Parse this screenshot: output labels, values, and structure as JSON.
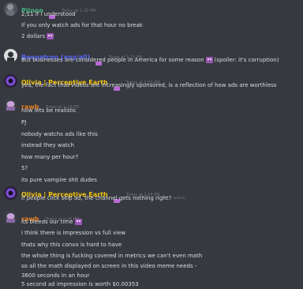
{
  "messages": [
    {
      "author": "Pjinon",
      "author_color": "#43b581",
      "timestamp": "Today at 1:22 PM",
      "lines": [
        "2,11 if i understood",
        "if you only watch ads for that hour no break",
        "2 dollars"
      ]
    },
    {
      "author": "Beepatron (any/all)",
      "author_color": "#5865f2",
      "timestamp": "Today at 1:23 PM",
      "lines": [
        "But businesses are considered people in America for some reason",
        "(spoiler: it's corruption)"
      ]
    },
    {
      "author": "Olivia | Perceptive Earth",
      "author_color": "#f1c40f",
      "timestamp": "Today at 1:23 PM",
      "lines": [
        "yea, the fact that videos are increasingly sponsored, is a reflection of how ads are worthless"
      ]
    },
    {
      "author": "rawb",
      "author_color": "#e67e22",
      "timestamp": "Today at 1:23 PM",
      "lines": [
        "now lets be realistic",
        "PJ",
        "nobody watchs ads like this",
        "instead they watch",
        "how many per hour?",
        "5?",
        "its pure vampire shit dudes"
      ]
    },
    {
      "author": "Olivia | Perceptive Earth",
      "author_color": "#f1c40f",
      "timestamp": "Today at 1:24 PM",
      "lines": [
        "If people click skip ad, the channel gets nothing right?"
      ],
      "edited": "(edited)"
    },
    {
      "author": "rawb",
      "author_color": "#e67e22",
      "timestamp": "Today at 1:26 PM",
      "lines": [
        "its bleeds our time",
        "i think there is impression vs full view",
        "thats why this convo is hard to have",
        "the whole thing is fucking covered in metrics we can't even math",
        "so all the math displayed on screen in this video meme needs -",
        "3600 seconds in an hour",
        "5 second ad impression is worth $0.00353"
      ]
    }
  ]
}
